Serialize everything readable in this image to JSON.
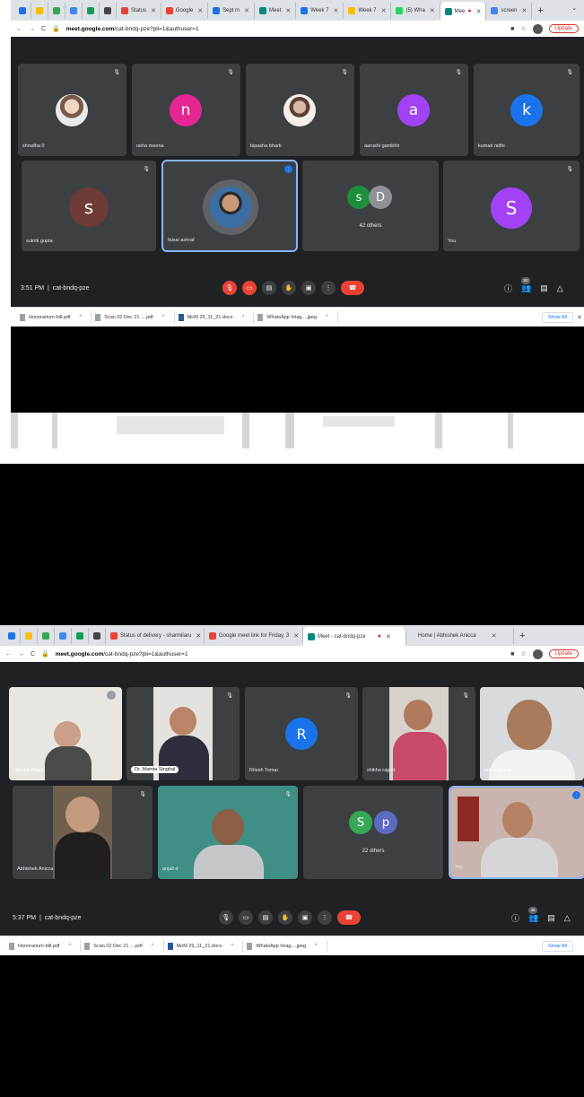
{
  "shot1": {
    "tabs": [
      {
        "label": "",
        "color": "#1a73e8"
      },
      {
        "label": "",
        "color": "#fbbc04"
      },
      {
        "label": "",
        "color": "#34a853"
      },
      {
        "label": "",
        "color": "#4285f4"
      },
      {
        "label": "",
        "color": "#0f9d58"
      },
      {
        "label": "",
        "color": "#444444"
      },
      {
        "label": "Status",
        "color": "#ea4335"
      },
      {
        "label": "Google",
        "color": "#ea4335"
      },
      {
        "label": "Sept m",
        "color": "#1a73e8"
      },
      {
        "label": "Meet",
        "color": "#00897b"
      },
      {
        "label": "Week 7",
        "color": "#1a73e8"
      },
      {
        "label": "Week 7",
        "color": "#fbbc04"
      },
      {
        "label": "(5) Wha",
        "color": "#25d366"
      },
      {
        "label": "Mee",
        "color": "#00897b"
      },
      {
        "label": "screen",
        "color": "#4285f4"
      }
    ],
    "url_host": "meet.google.com",
    "url_path": "/cat-bndq-pze?pli=1&authuser=1",
    "update_label": "Update",
    "tiles": [
      {
        "name": "shradha 0",
        "avatar_type": "photo",
        "letter": "",
        "color": "#d8d8d8"
      },
      {
        "name": "neha meena",
        "avatar_type": "letter",
        "letter": "n",
        "color": "#e52592"
      },
      {
        "name": "bipasha bharti",
        "avatar_type": "photo",
        "letter": "",
        "color": "#f1e6da"
      },
      {
        "name": "aarushi gambhir",
        "avatar_type": "letter",
        "letter": "a",
        "color": "#a142f4"
      },
      {
        "name": "kumari nidhi",
        "avatar_type": "letter",
        "letter": "k",
        "color": "#1a73e8"
      },
      {
        "name": "sukriti gupta",
        "avatar_type": "letter",
        "letter": "s",
        "color": "#6d3a35"
      },
      {
        "name": "faisal ashraf",
        "avatar_type": "photo",
        "letter": "",
        "color": "#3b6ea5"
      },
      {
        "name": "You",
        "avatar_type": "letter",
        "letter": "S",
        "color": "#a142f4"
      }
    ],
    "others": {
      "letters": [
        "s",
        "D"
      ],
      "colors": [
        "#1e8e3e",
        "#5f6368"
      ],
      "label": "42 others"
    },
    "time": "3:51 PM",
    "meeting_code": "cat-bndq-pze",
    "people_count": "50",
    "downloads": [
      {
        "name": "Honorarium-bill.pdf",
        "type": "pdf"
      },
      {
        "name": "Scan 02 Dec 21 ....pdf",
        "type": "pdf"
      },
      {
        "name": "MoM 29_11_21.docx",
        "type": "word"
      },
      {
        "name": "WhatsApp Imag....jpeg",
        "type": "img"
      }
    ],
    "show_all": "Show All"
  },
  "shot2": {
    "tabs": [
      {
        "label": "",
        "color": "#1a73e8"
      },
      {
        "label": "",
        "color": "#fbbc04"
      },
      {
        "label": "",
        "color": "#34a853"
      },
      {
        "label": "",
        "color": "#4285f4"
      },
      {
        "label": "",
        "color": "#0f9d58"
      },
      {
        "label": "",
        "color": "#444444"
      },
      {
        "label": "Status of delivery - sharmilaru",
        "color": "#ea4335"
      },
      {
        "label": "Google meet link for Friday, 3",
        "color": "#ea4335"
      },
      {
        "label": "Meet - cat-bndq-pze",
        "color": "#00897b"
      },
      {
        "label": "Home | Abhishek Aniccа",
        "color": "#ffffff"
      }
    ],
    "url_host": "meet.google.com",
    "url_path": "/cat-bndq-pze?pli=1&authuser=1",
    "update_label": "Update",
    "tiles": [
      {
        "name": "Ujjwala Bharti",
        "kind": "video",
        "bg": "#e9e6e2"
      },
      {
        "name": "Dr. Mamta Singhal",
        "kind": "video",
        "bg": "#3a3530"
      },
      {
        "name": "Ritesh Tomar",
        "kind": "letter",
        "letter": "R",
        "color": "#1a73e8"
      },
      {
        "name": "shikha rajput",
        "kind": "video",
        "bg": "#c94a6a"
      },
      {
        "name": "faisal ashraf",
        "kind": "video",
        "bg": "#d8dadd"
      },
      {
        "name": "Abhishek Anicca",
        "kind": "video",
        "bg": "#7a6a55"
      },
      {
        "name": "anjali d",
        "kind": "video",
        "bg": "#3f8f86"
      },
      {
        "name": "You",
        "kind": "video",
        "bg": "#c9b5ad"
      }
    ],
    "others": {
      "letters": [
        "S",
        "p"
      ],
      "colors": [
        "#34a853",
        "#5c6bc0"
      ],
      "label": "22 others"
    },
    "time": "5:37 PM",
    "meeting_code": "cat-bndq-pze",
    "people_count": "30",
    "downloads": [
      {
        "name": "Honorarium-bill.pdf",
        "type": "pdf"
      },
      {
        "name": "Scan 02 Dec 21 ....pdf",
        "type": "pdf"
      },
      {
        "name": "MoM 29_11_21.docx",
        "type": "word"
      },
      {
        "name": "WhatsApp Imag....jpeg",
        "type": "img"
      }
    ],
    "show_all": "Show All"
  }
}
